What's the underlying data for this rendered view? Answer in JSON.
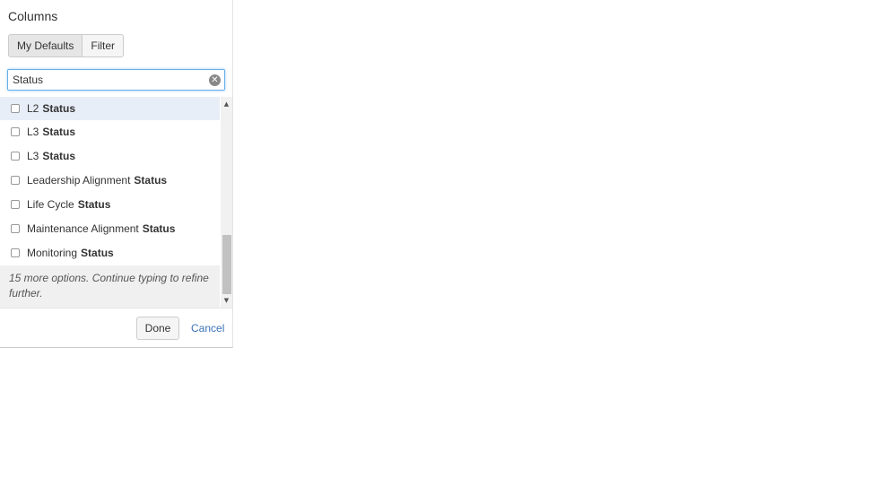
{
  "panel": {
    "title": "Columns",
    "tabs": [
      {
        "label": "My Defaults",
        "active": true
      },
      {
        "label": "Filter",
        "active": false
      }
    ],
    "search": {
      "value": "Status",
      "placeholder": ""
    },
    "items": [
      {
        "prefix": "L2",
        "match": "Status",
        "checked": false,
        "highlighted": true
      },
      {
        "prefix": "L3",
        "match": "Status",
        "checked": false,
        "highlighted": false
      },
      {
        "prefix": "L3",
        "match": "Status",
        "checked": false,
        "highlighted": false
      },
      {
        "prefix": "Leadership Alignment",
        "match": "Status",
        "checked": false,
        "highlighted": false
      },
      {
        "prefix": "Life Cycle",
        "match": "Status",
        "checked": false,
        "highlighted": false
      },
      {
        "prefix": "Maintenance Alignment",
        "match": "Status",
        "checked": false,
        "highlighted": false
      },
      {
        "prefix": "Monitoring",
        "match": "Status",
        "checked": false,
        "highlighted": false
      }
    ],
    "more_options_text": "15 more options. Continue typing to refine further.",
    "done_label": "Done",
    "cancel_label": "Cancel"
  },
  "colors": {
    "focus_border": "#66afe9",
    "highlight_row": "#e8eef8",
    "link": "#3b73b9"
  },
  "icons": {
    "clear": "clear-circle-icon",
    "scroll_up": "scroll-up-arrow-icon",
    "scroll_down": "scroll-down-arrow-icon"
  }
}
